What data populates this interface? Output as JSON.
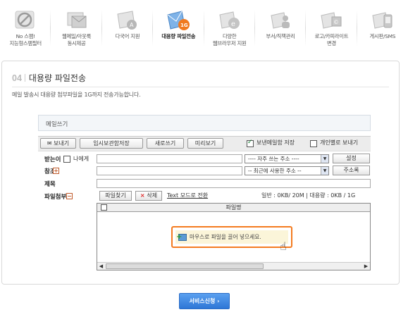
{
  "features": [
    {
      "icon": "no-spam-icon",
      "label": "No 스팸!\n지능형스팸필터"
    },
    {
      "icon": "webmail-icon",
      "label": "웹메일/아웃룩\n동시제공"
    },
    {
      "icon": "multilang-icon",
      "label": "다국어 지원"
    },
    {
      "icon": "large-file-icon",
      "label": "대용량 파일전송",
      "active": true
    },
    {
      "icon": "multi-browser-icon",
      "label": "다양한\n웹브라우저 지원"
    },
    {
      "icon": "department-icon",
      "label": "부서/직책관리"
    },
    {
      "icon": "logo-color-icon",
      "label": "로고/카피라이트\n변경"
    },
    {
      "icon": "board-sms-icon",
      "label": "게시판/SMS"
    }
  ],
  "section": {
    "number": "04",
    "title": "대용량 파일전송",
    "description": "메일 발송시 대용량 첨부파일을 1G까지 전송가능합니다."
  },
  "composer": {
    "title": "메일쓰기",
    "toolbar": {
      "send": "보내기",
      "draft": "임시보관함저장",
      "new": "새로쓰기",
      "preview": "미리보기",
      "save_sent": "보낸메일함 저장",
      "save_sent_checked": true,
      "individual": "개인별로 보내기"
    },
    "fields": {
      "to_label": "받는이",
      "to_me": "나에게",
      "frequent": "---- 자주 쓰는 주소 ----",
      "settings": "설정",
      "cc_label": "참조",
      "recent": "-- 최근에 사용한 주소 --",
      "addressbook": "주소록",
      "subject_label": "제목",
      "attach_label": "파일첨부"
    },
    "attach": {
      "find": "파일찾기",
      "delete": "삭제",
      "text_mode": "Text 모드로 전환",
      "usage": "일반 : 0KB/ 20M | 대용량 : 0KB / 1G",
      "column": "파일명",
      "drop_tip": "마우스로 파일을 끌어 넣으세요."
    }
  },
  "service_button": "서비스신청 ›"
}
